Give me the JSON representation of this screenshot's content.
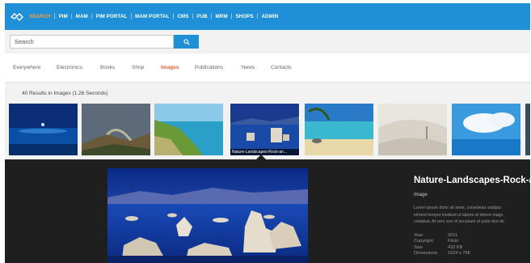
{
  "nav": {
    "items": [
      {
        "label": "SEARCH",
        "active": true
      },
      {
        "label": "PIM",
        "active": false
      },
      {
        "label": "MAM",
        "active": false
      },
      {
        "label": "PIM PORTAL",
        "active": false
      },
      {
        "label": "MAM PORTAL",
        "active": false
      },
      {
        "label": "CMS",
        "active": false
      },
      {
        "label": "PUB",
        "active": false
      },
      {
        "label": "MRM",
        "active": false
      },
      {
        "label": "SHOPS",
        "active": false
      },
      {
        "label": "ADMIN",
        "active": false
      }
    ]
  },
  "search": {
    "placeholder": "Search",
    "button_icon": "search-icon"
  },
  "tabs": [
    {
      "label": "Everywhere",
      "active": false
    },
    {
      "label": "Electronics",
      "active": false
    },
    {
      "label": "Books",
      "active": false
    },
    {
      "label": "Shop",
      "active": false
    },
    {
      "label": "Images",
      "active": true
    },
    {
      "label": "Publications",
      "active": false
    },
    {
      "label": "News",
      "active": false
    },
    {
      "label": "Contacts",
      "active": false
    }
  ],
  "results": {
    "count_text": "40 Results in Images (1.26 Seconds)",
    "thumbnails": [
      {
        "scene": "night-sea"
      },
      {
        "scene": "rainbow-valley"
      },
      {
        "scene": "green-coast"
      },
      {
        "scene": "rock-lake",
        "caption": "Nature-Landscapes-Rock-an..."
      },
      {
        "scene": "tropical-beach"
      },
      {
        "scene": "sand-dunes"
      },
      {
        "scene": "clouds-sea"
      },
      {
        "scene": "partial"
      }
    ]
  },
  "detail": {
    "title": "Nature-Landscapes-Rock-an",
    "type": "Image",
    "description": [
      "Lorem ipsum dolor sit amet, consetetur sadipsc",
      "eirmod tempor invidunt ut labore et dolore magn",
      "voluptua. At vero eos et accusam et justo duo do"
    ],
    "meta": [
      {
        "key": "Year",
        "value": "2011"
      },
      {
        "key": "Copyright",
        "value": "Flickr"
      },
      {
        "key": "Size",
        "value": "433 KB"
      },
      {
        "key": "Dimensions",
        "value": "1024 x 768"
      }
    ]
  },
  "colors": {
    "brand_blue": "#1f8fd8",
    "active_nav": "#ff9a3d",
    "active_tab": "#e8643a",
    "detail_bg": "#1f1f1f"
  }
}
